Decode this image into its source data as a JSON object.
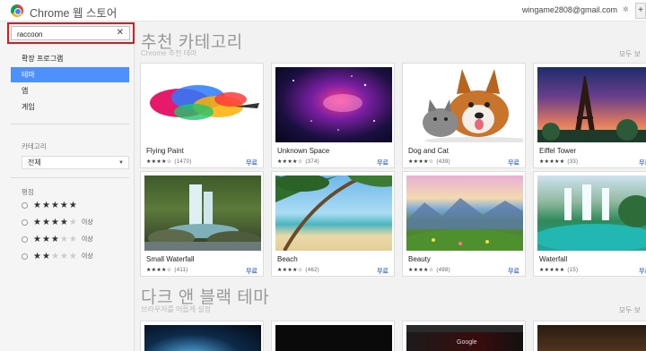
{
  "header": {
    "store_title": "Chrome 웹 스토어",
    "user_email": "wingame2808@gmail.com",
    "settings_label": "✲",
    "user_button": "+"
  },
  "search": {
    "value": "raccoon",
    "clear_label": "✕"
  },
  "nav": [
    {
      "label": "확장 프로그램",
      "active": false
    },
    {
      "label": "테마",
      "active": true
    },
    {
      "label": "앱",
      "active": false
    },
    {
      "label": "게임",
      "active": false
    }
  ],
  "category": {
    "label": "카테고리",
    "selected": "전체"
  },
  "rating": {
    "label": "평점",
    "rows": [
      {
        "filled": 5,
        "suffix": ""
      },
      {
        "filled": 4,
        "suffix": "이상"
      },
      {
        "filled": 3,
        "suffix": "이상"
      },
      {
        "filled": 2,
        "suffix": "이상"
      }
    ]
  },
  "sections": [
    {
      "title": "추천 카테고리",
      "subtitle": "Chrome 추천 테마",
      "see_all": "모두 보",
      "cards": [
        {
          "name": "Flying Paint",
          "stars": "★★★★☆",
          "count": "(1470)",
          "price": "무료"
        },
        {
          "name": "Unknown Space",
          "stars": "★★★★☆",
          "count": "(374)",
          "price": "무료"
        },
        {
          "name": "Dog and Cat",
          "stars": "★★★★☆",
          "count": "(439)",
          "price": "무료"
        },
        {
          "name": "Eiffel Tower",
          "stars": "★★★★★",
          "count": "(33)",
          "price": "무료"
        },
        {
          "name": "Small Waterfall",
          "stars": "★★★★☆",
          "count": "(411)",
          "price": "무료"
        },
        {
          "name": "Beach",
          "stars": "★★★★☆",
          "count": "(462)",
          "price": "무료"
        },
        {
          "name": "Beauty",
          "stars": "★★★★☆",
          "count": "(498)",
          "price": "무료"
        },
        {
          "name": "Waterfall",
          "stars": "★★★★★",
          "count": "(15)",
          "price": "무료"
        }
      ]
    },
    {
      "title": "다크 앤 블랙 테마",
      "subtitle": "브라우저를 어둡게 설정",
      "see_all": "모두 보",
      "preview_text": "Google"
    }
  ]
}
